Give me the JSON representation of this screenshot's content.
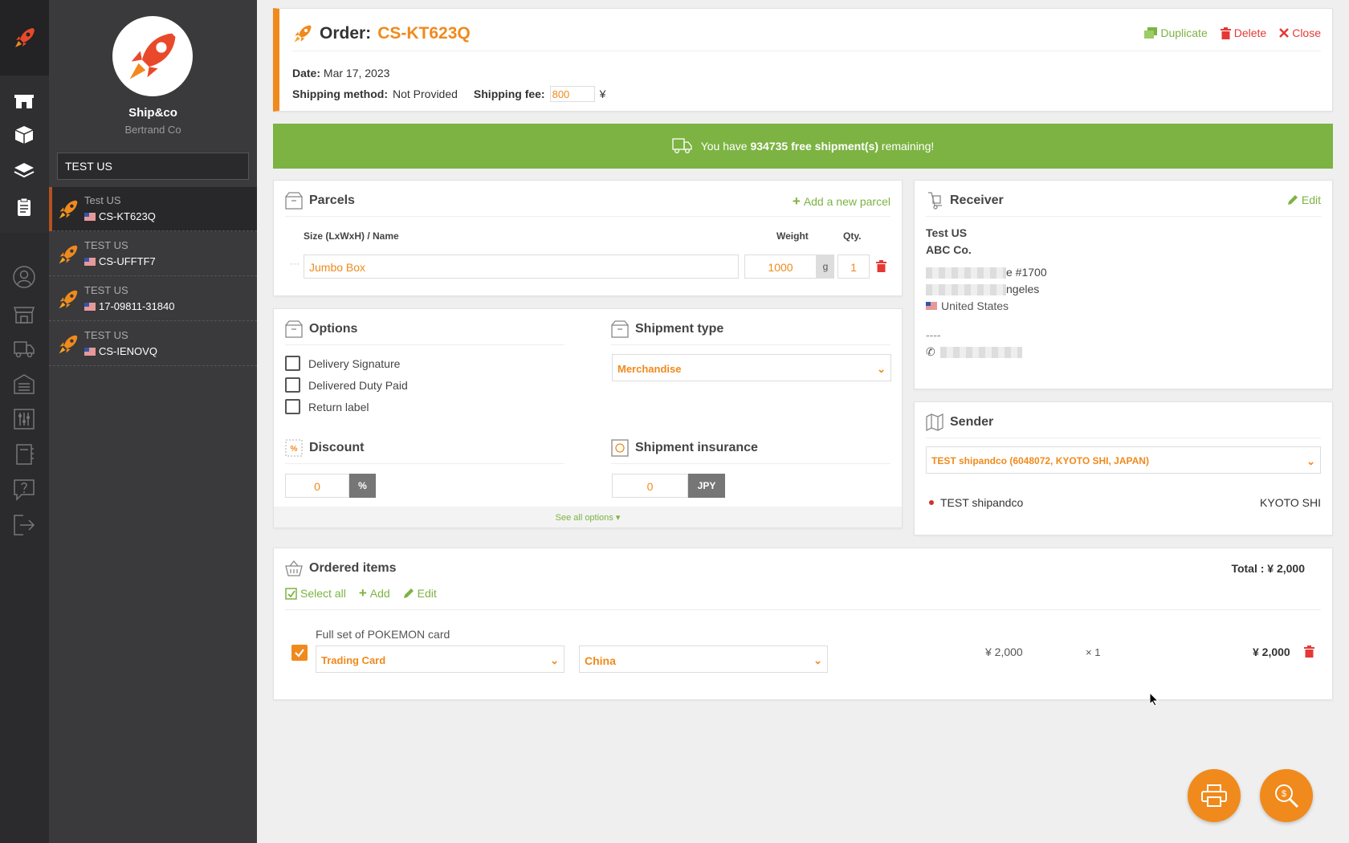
{
  "sidebar": {
    "company_name": "Ship&co",
    "company_sub": "Bertrand Co",
    "search_value": "TEST US",
    "orders": [
      {
        "name": "Test US",
        "id": "CS-KT623Q",
        "active": true
      },
      {
        "name": "TEST US",
        "id": "CS-UFFTF7",
        "active": false
      },
      {
        "name": "TEST US",
        "id": "17-09811-31840",
        "active": false
      },
      {
        "name": "TEST US",
        "id": "CS-IENOVQ",
        "active": false
      }
    ]
  },
  "header": {
    "title_prefix": "Order:",
    "order_id": "CS-KT623Q",
    "duplicate": "Duplicate",
    "delete": "Delete",
    "close": "Close",
    "date_label": "Date:",
    "date_value": "Mar 17, 2023",
    "method_label": "Shipping method:",
    "method_value": "Not Provided",
    "fee_label": "Shipping fee:",
    "fee_value": "800",
    "fee_currency": "¥"
  },
  "banner": {
    "pre": "You have",
    "count": "934735 free shipment(s)",
    "post": "remaining!"
  },
  "parcels": {
    "title": "Parcels",
    "add": "Add a new parcel",
    "col_size": "Size (LxWxH) / Name",
    "col_weight": "Weight",
    "col_qty": "Qty.",
    "name": "Jumbo Box",
    "weight": "1000",
    "unit": "g",
    "qty": "1"
  },
  "options": {
    "title": "Options",
    "items": [
      "Delivery Signature",
      "Delivered Duty Paid",
      "Return label"
    ],
    "shipment_type_title": "Shipment type",
    "shipment_type_value": "Merchandise",
    "discount_title": "Discount",
    "discount_value": "0",
    "discount_unit": "%",
    "insurance_title": "Shipment insurance",
    "insurance_value": "0",
    "insurance_unit": "JPY",
    "see_all": "See all options ▾"
  },
  "receiver": {
    "title": "Receiver",
    "edit": "Edit",
    "name": "Test US",
    "company": "ABC Co.",
    "addr1_tail": "e #1700",
    "addr2_tail": "ngeles",
    "country": "United States",
    "dashes": "----"
  },
  "sender": {
    "title": "Sender",
    "select_value": "TEST shipandco (6048072, KYOTO SHI, JAPAN)",
    "name": "TEST shipandco",
    "city": "KYOTO SHI"
  },
  "ordered": {
    "title": "Ordered items",
    "total": "Total : ¥ 2,000",
    "select_all": "Select all",
    "add": "Add",
    "edit": "Edit",
    "item_name": "Full set of POKEMON card",
    "category": "Trading Card",
    "origin": "China",
    "unit_price": "¥ 2,000",
    "qty": "× 1",
    "line_total": "¥ 2,000"
  },
  "colors": {
    "accent": "#f08a1c",
    "green": "#7cb342",
    "red": "#e53935",
    "sidebar": "#3a393b"
  }
}
